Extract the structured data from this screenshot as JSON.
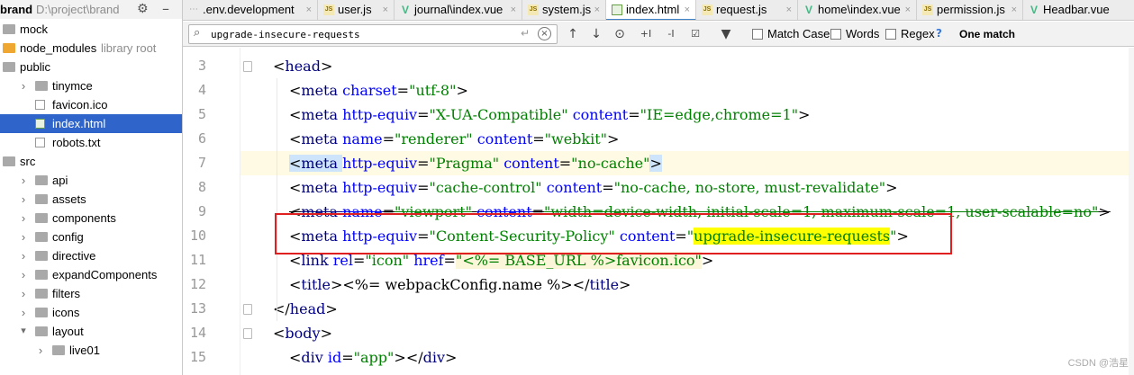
{
  "sidebar": {
    "items": [
      {
        "label": "brand",
        "suffix": "D:\\project\\brand",
        "kind": "root",
        "depth": 0,
        "arrow": "open"
      },
      {
        "label": "mock",
        "kind": "folder",
        "depth": 0,
        "arrow": "none"
      },
      {
        "label": "node_modules",
        "suffix": "library root",
        "kind": "folder-excl",
        "depth": 0,
        "arrow": "none"
      },
      {
        "label": "public",
        "kind": "folder",
        "depth": 0,
        "arrow": "none"
      },
      {
        "label": "tinymce",
        "kind": "folder",
        "depth": 1,
        "arrow": "closed"
      },
      {
        "label": "favicon.ico",
        "kind": "ico",
        "depth": 1,
        "arrow": "none"
      },
      {
        "label": "index.html",
        "kind": "html",
        "depth": 1,
        "arrow": "none",
        "selected": true
      },
      {
        "label": "robots.txt",
        "kind": "txt",
        "depth": 1,
        "arrow": "none"
      },
      {
        "label": "src",
        "kind": "folder",
        "depth": 0,
        "arrow": "none"
      },
      {
        "label": "api",
        "kind": "folder",
        "depth": 1,
        "arrow": "closed"
      },
      {
        "label": "assets",
        "kind": "folder",
        "depth": 1,
        "arrow": "closed"
      },
      {
        "label": "components",
        "kind": "folder",
        "depth": 1,
        "arrow": "closed"
      },
      {
        "label": "config",
        "kind": "folder",
        "depth": 1,
        "arrow": "closed"
      },
      {
        "label": "directive",
        "kind": "folder",
        "depth": 1,
        "arrow": "closed"
      },
      {
        "label": "expandComponents",
        "kind": "folder",
        "depth": 1,
        "arrow": "closed"
      },
      {
        "label": "filters",
        "kind": "folder",
        "depth": 1,
        "arrow": "closed"
      },
      {
        "label": "icons",
        "kind": "folder",
        "depth": 1,
        "arrow": "closed"
      },
      {
        "label": "layout",
        "kind": "folder",
        "depth": 1,
        "arrow": "open"
      },
      {
        "label": "live01",
        "kind": "folder",
        "depth": 2,
        "arrow": "closed"
      }
    ]
  },
  "tabs": [
    {
      "label": ".env.development",
      "icon": "env"
    },
    {
      "label": "user.js",
      "icon": "js"
    },
    {
      "label": "journal\\index.vue",
      "icon": "vue"
    },
    {
      "label": "system.js",
      "icon": "js"
    },
    {
      "label": "index.html",
      "icon": "htm",
      "active": true
    },
    {
      "label": "request.js",
      "icon": "js"
    },
    {
      "label": "home\\index.vue",
      "icon": "vue"
    },
    {
      "label": "permission.js",
      "icon": "js"
    },
    {
      "label": "Headbar.vue",
      "icon": "vue"
    }
  ],
  "find": {
    "query": "upgrade-insecure-requests",
    "match_case": "Match Case",
    "words": "Words",
    "regex": "Regex",
    "help": "?",
    "result": "One match"
  },
  "editor": {
    "line_numbers": [
      "3",
      "4",
      "5",
      "6",
      "7",
      "8",
      "9",
      "10",
      "11",
      "12",
      "13",
      "14",
      "15"
    ],
    "lines": [
      {
        "tokens": [
          [
            "<",
            "bk"
          ],
          [
            "head",
            "tg"
          ],
          [
            ">",
            "bk"
          ]
        ]
      },
      {
        "tokens": [
          [
            "<",
            "bk"
          ],
          [
            "meta ",
            "tg"
          ],
          [
            "charset",
            "at"
          ],
          [
            "=",
            "bk"
          ],
          [
            "\"utf-8\"",
            "av"
          ],
          [
            ">",
            "bk"
          ]
        ]
      },
      {
        "tokens": [
          [
            "<",
            "bk"
          ],
          [
            "meta ",
            "tg"
          ],
          [
            "http-equiv",
            "at"
          ],
          [
            "=",
            "bk"
          ],
          [
            "\"X-UA-Compatible\"",
            "av"
          ],
          [
            " ",
            "bk"
          ],
          [
            "content",
            "at"
          ],
          [
            "=",
            "bk"
          ],
          [
            "\"IE=edge,chrome=1\"",
            "av"
          ],
          [
            ">",
            "bk"
          ]
        ]
      },
      {
        "tokens": [
          [
            "<",
            "bk"
          ],
          [
            "meta ",
            "tg"
          ],
          [
            "name",
            "at"
          ],
          [
            "=",
            "bk"
          ],
          [
            "\"renderer\"",
            "av"
          ],
          [
            " ",
            "bk"
          ],
          [
            "content",
            "at"
          ],
          [
            "=",
            "bk"
          ],
          [
            "\"webkit\"",
            "av"
          ],
          [
            ">",
            "bk"
          ]
        ]
      },
      {
        "tokens": [
          [
            "<",
            "bk"
          ],
          [
            "meta ",
            "tg"
          ],
          [
            "http-equiv",
            "at"
          ],
          [
            "=",
            "bk"
          ],
          [
            "\"Pragma\"",
            "av"
          ],
          [
            " ",
            "bk"
          ],
          [
            "content",
            "at"
          ],
          [
            "=",
            "bk"
          ],
          [
            "\"no-cache\"",
            "av"
          ],
          [
            ">",
            "bk"
          ]
        ]
      },
      {
        "tokens": [
          [
            "<",
            "bk"
          ],
          [
            "meta ",
            "tg"
          ],
          [
            "http-equiv",
            "at"
          ],
          [
            "=",
            "bk"
          ],
          [
            "\"cache-control\"",
            "av"
          ],
          [
            " ",
            "bk"
          ],
          [
            "content",
            "at"
          ],
          [
            "=",
            "bk"
          ],
          [
            "\"no-cache, no-store, must-revalidate\"",
            "av"
          ],
          [
            ">",
            "bk"
          ]
        ]
      },
      {
        "tokens": [
          [
            "<",
            "bk"
          ],
          [
            "meta ",
            "tg"
          ],
          [
            "name",
            "at"
          ],
          [
            "=",
            "bk"
          ],
          [
            "\"viewport\"",
            "av"
          ],
          [
            " ",
            "bk"
          ],
          [
            "content",
            "at"
          ],
          [
            "=",
            "bk"
          ],
          [
            "\"width=device-width, initial-scale=1, maximum-scale=1, user-scalable=no\"",
            "av"
          ],
          [
            ">",
            "bk"
          ]
        ]
      },
      {
        "tokens": [
          [
            "<",
            "bk"
          ],
          [
            "meta ",
            "tg"
          ],
          [
            "http-equiv",
            "at"
          ],
          [
            "=",
            "bk"
          ],
          [
            "\"Content-Security-Policy\"",
            "av"
          ],
          [
            " ",
            "bk"
          ],
          [
            "content",
            "at"
          ],
          [
            "=",
            "bk"
          ],
          [
            "\"",
            "av"
          ],
          [
            "upgrade-insecure-requests",
            "av"
          ],
          [
            "\"",
            "av"
          ],
          [
            ">",
            "bk"
          ]
        ]
      },
      {
        "tokens": [
          [
            "<",
            "bk"
          ],
          [
            "link ",
            "tg"
          ],
          [
            "rel",
            "at"
          ],
          [
            "=",
            "bk"
          ],
          [
            "\"icon\"",
            "av"
          ],
          [
            " ",
            "bk"
          ],
          [
            "href",
            "at"
          ],
          [
            "=",
            "bk"
          ],
          [
            "\"<%= BASE_URL %>favicon.ico\"",
            "av"
          ],
          [
            ">",
            "bk"
          ]
        ]
      },
      {
        "tokens": [
          [
            "<",
            "bk"
          ],
          [
            "title",
            "tg"
          ],
          [
            ">",
            "bk"
          ],
          [
            "<%= webpackConfig.name %>",
            "bk"
          ],
          [
            "</",
            "bk"
          ],
          [
            "title",
            "tg"
          ],
          [
            ">",
            "bk"
          ]
        ]
      },
      {
        "tokens": [
          [
            "</",
            "bk"
          ],
          [
            "head",
            "tg"
          ],
          [
            ">",
            "bk"
          ]
        ]
      },
      {
        "tokens": [
          [
            "<",
            "bk"
          ],
          [
            "body",
            "tg"
          ],
          [
            ">",
            "bk"
          ]
        ]
      },
      {
        "tokens": [
          [
            "<",
            "bk"
          ],
          [
            "div ",
            "tg"
          ],
          [
            "id",
            "at"
          ],
          [
            "=",
            "bk"
          ],
          [
            "\"app\"",
            "av"
          ],
          [
            ">",
            "bk"
          ],
          [
            "</",
            "bk"
          ],
          [
            "div",
            "tg"
          ],
          [
            ">",
            "bk"
          ]
        ]
      }
    ]
  },
  "watermark": "CSDN @浩星",
  "colors": {
    "accent": "#2f65ca",
    "highlight": "#ffff00",
    "annotation": "#e02020"
  }
}
